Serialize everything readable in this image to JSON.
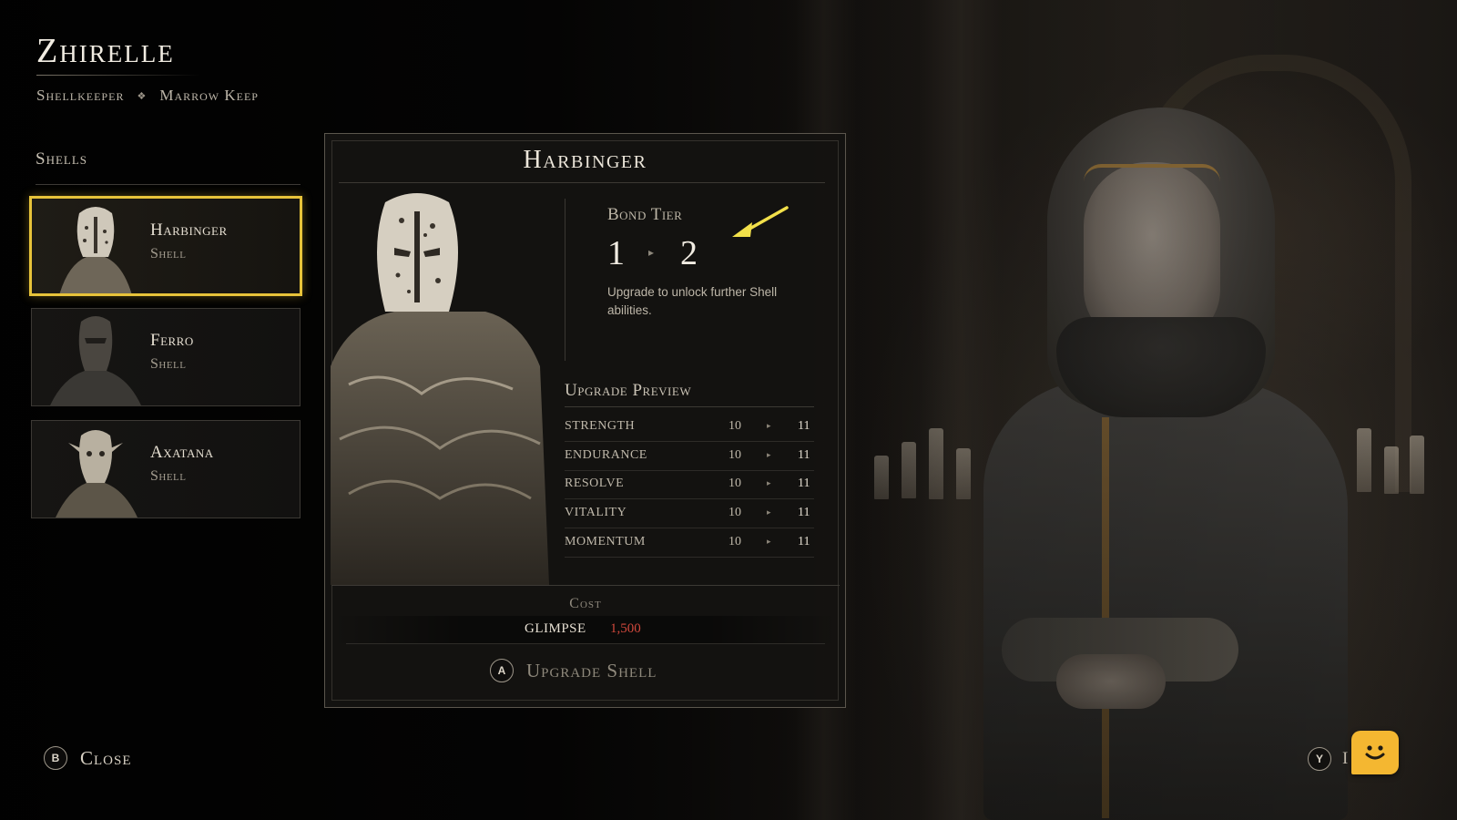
{
  "character": {
    "name": "Zhirelle",
    "role": "Shellkeeper",
    "separator": "❖",
    "location": "Marrow Keep"
  },
  "shells_panel": {
    "title": "Shells",
    "items": [
      {
        "name": "Harbinger",
        "subtitle": "Shell",
        "selected": true
      },
      {
        "name": "Ferro",
        "subtitle": "Shell",
        "selected": false
      },
      {
        "name": "Axatana",
        "subtitle": "Shell",
        "selected": false
      }
    ]
  },
  "detail": {
    "title": "Harbinger",
    "bond_tier": {
      "label": "Bond Tier",
      "from": "1",
      "arrow": "▸",
      "to": "2",
      "description": "Upgrade to unlock further Shell abilities."
    },
    "upgrade_preview": {
      "title": "Upgrade Preview",
      "stats": [
        {
          "name": "STRENGTH",
          "from": "10",
          "arrow": "▸",
          "to": "11"
        },
        {
          "name": "ENDURANCE",
          "from": "10",
          "arrow": "▸",
          "to": "11"
        },
        {
          "name": "RESOLVE",
          "from": "10",
          "arrow": "▸",
          "to": "11"
        },
        {
          "name": "VITALITY",
          "from": "10",
          "arrow": "▸",
          "to": "11"
        },
        {
          "name": "MOMENTUM",
          "from": "10",
          "arrow": "▸",
          "to": "11"
        }
      ]
    },
    "cost": {
      "label": "Cost",
      "currency": "GLIMPSE",
      "amount": "1,500"
    },
    "upgrade_button": {
      "glyph": "A",
      "label": "Upgrade Shell"
    }
  },
  "footer": {
    "close": {
      "glyph": "B",
      "label": "Close"
    },
    "secondary": {
      "glyph": "Y",
      "label": "I"
    }
  },
  "colors": {
    "selection_gold": "#e7c33a",
    "cost_red": "#d0483c",
    "pointer_arrow": "#f2e04a",
    "chat_widget": "#f4b731"
  },
  "icons": {
    "pointer": "arrow-pointer-icon",
    "chat": "chat-smile-icon"
  }
}
